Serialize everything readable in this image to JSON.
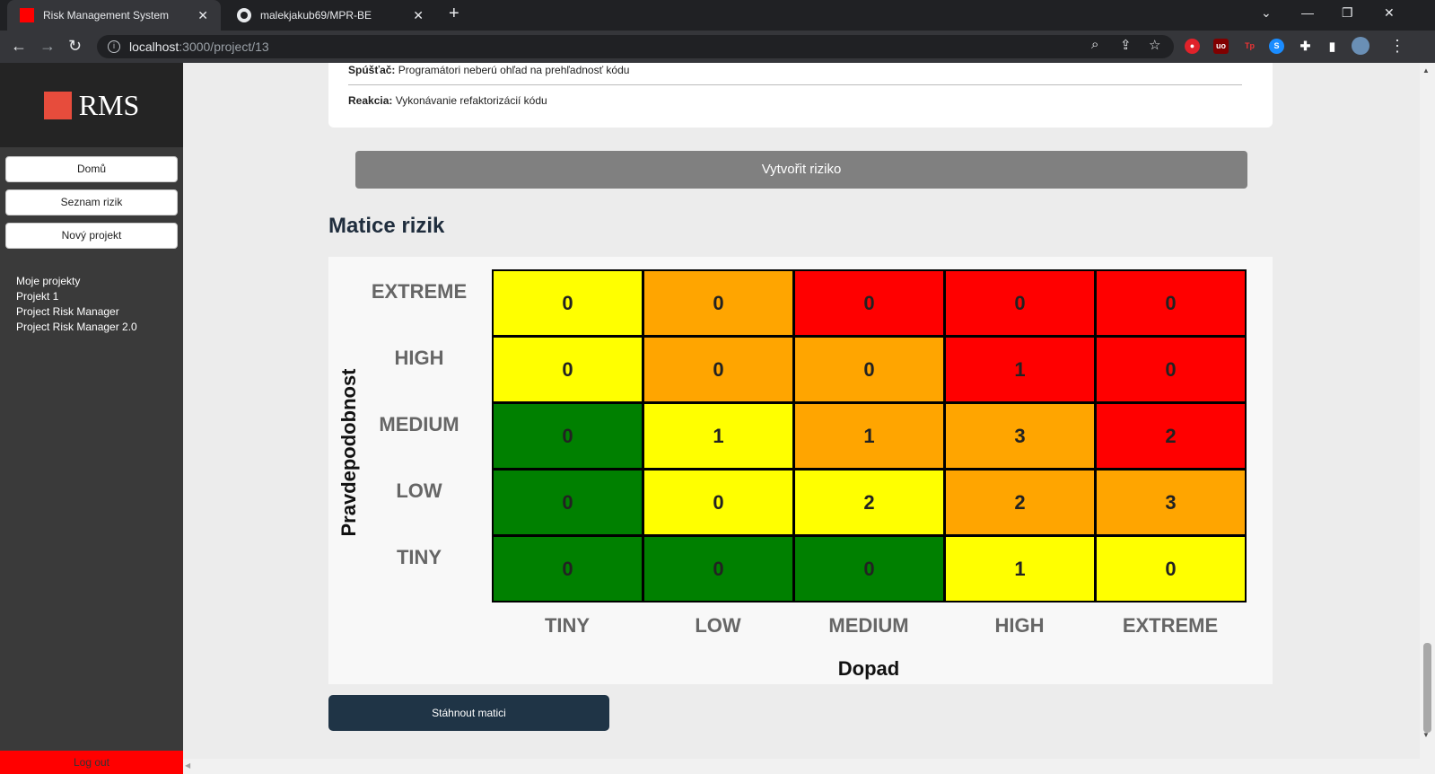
{
  "browser": {
    "tabs": [
      {
        "title": "Risk Management System",
        "active": true
      },
      {
        "title": "malekjakub69/MPR-BE",
        "active": false
      }
    ],
    "url_host": "localhost",
    "url_path": ":3000/project/13"
  },
  "sidebar": {
    "brand": "RMS",
    "buttons": [
      "Domů",
      "Seznam rizik",
      "Nový projekt"
    ],
    "projects_heading": "Moje projekty",
    "projects": [
      "Projekt 1",
      "Project Risk Manager",
      "Project Risk Manager 2.0"
    ],
    "logout": "Log out"
  },
  "risk_card": {
    "trigger_label": "Spúšťač:",
    "trigger_text": "Programátori neberú ohľad na prehľadnosť kódu",
    "reaction_label": "Reakcia:",
    "reaction_text": "Vykonávanie refaktorizácií kódu"
  },
  "create_button": "Vytvořit riziko",
  "matrix_title": "Matice rizik",
  "download_button": "Stáhnout matici",
  "colors": {
    "green": "#008000",
    "yellow": "#ffff00",
    "orange": "#ffa500",
    "red": "#ff0000"
  },
  "chart_data": {
    "type": "heatmap",
    "ylabel": "Pravdepodobnost",
    "xlabel": "Dopad",
    "rows": [
      "EXTREME",
      "HIGH",
      "MEDIUM",
      "LOW",
      "TINY"
    ],
    "columns": [
      "TINY",
      "LOW",
      "MEDIUM",
      "HIGH",
      "EXTREME"
    ],
    "values": [
      [
        0,
        0,
        0,
        0,
        0
      ],
      [
        0,
        0,
        0,
        1,
        0
      ],
      [
        0,
        1,
        1,
        3,
        2
      ],
      [
        0,
        0,
        2,
        2,
        3
      ],
      [
        0,
        0,
        0,
        1,
        0
      ]
    ],
    "cell_colors": [
      [
        "yellow",
        "orange",
        "red",
        "red",
        "red"
      ],
      [
        "yellow",
        "orange",
        "orange",
        "red",
        "red"
      ],
      [
        "green",
        "yellow",
        "orange",
        "orange",
        "red"
      ],
      [
        "green",
        "yellow",
        "yellow",
        "orange",
        "orange"
      ],
      [
        "green",
        "green",
        "green",
        "yellow",
        "yellow"
      ]
    ]
  }
}
